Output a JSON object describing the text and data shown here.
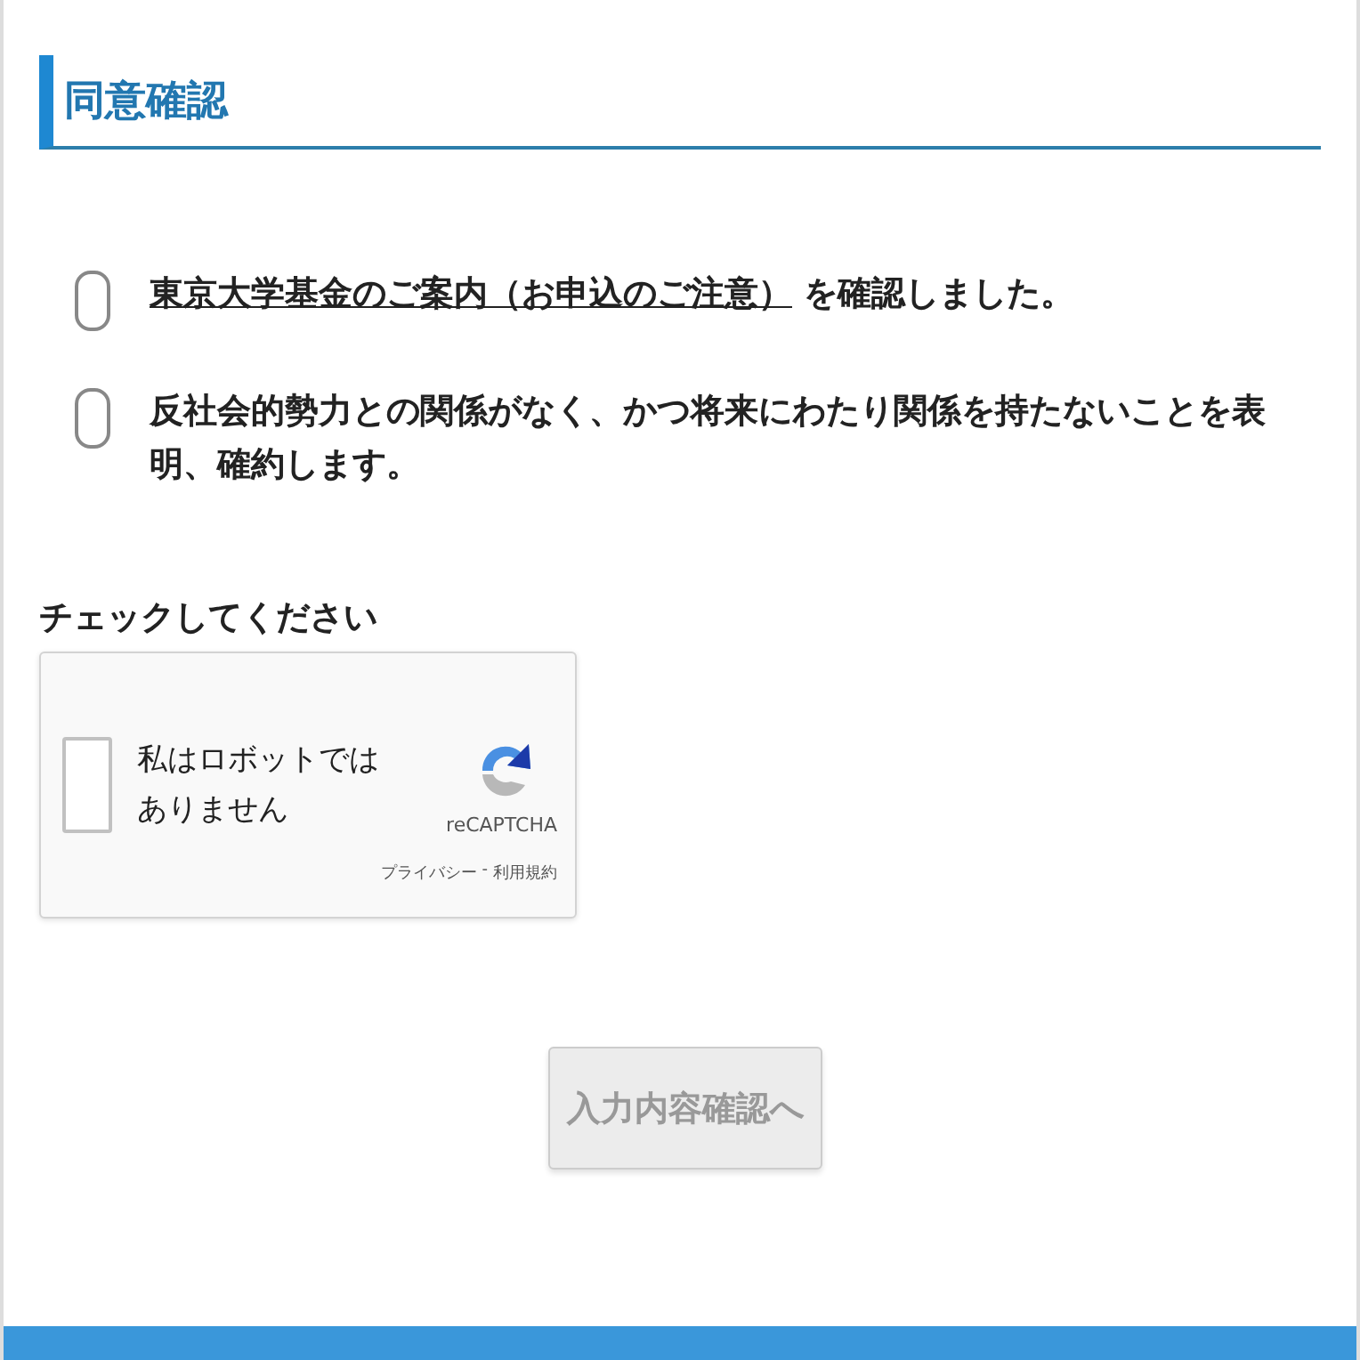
{
  "section": {
    "title": "同意確認"
  },
  "agreements": [
    {
      "kind": "link",
      "link": "東京大学基金のご案内（お申込のご注意）",
      "text": "を確認しました。",
      "checked": false
    },
    {
      "kind": "plain",
      "text": "反社会的勢力との関係がなく、かつ将来にわたり関係を持たないことを表明、確約します。",
      "checked": false
    }
  ],
  "captcha": {
    "label": "チェックしてください",
    "prompt": "私はロボットではありません",
    "checked": false,
    "brand": "reCAPTCHA",
    "privacy": "プライバシー",
    "separator": "-",
    "terms": "利用規約"
  },
  "submit": {
    "label": "入力内容確認へ",
    "disabled": true
  }
}
